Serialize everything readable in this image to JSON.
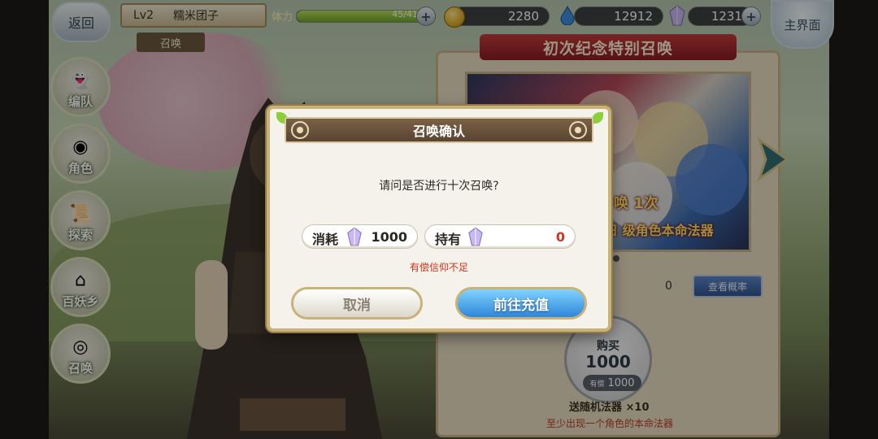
{
  "header": {
    "back_label": "返回",
    "level": "Lv2",
    "player_name": "糯米团子",
    "current_tab": "召唤",
    "stamina_label": "体力",
    "stamina_value": "45/41",
    "stamina_fill": 1.0,
    "gold": "2280",
    "spirit": "12912",
    "crystal": "1231",
    "home_label": "主界面"
  },
  "sidebar": {
    "items": [
      {
        "label": "编队",
        "icon": "ghost-icon"
      },
      {
        "label": "角色",
        "icon": "character-icon"
      },
      {
        "label": "探索",
        "icon": "scroll-icon"
      },
      {
        "label": "百妖乡",
        "icon": "village-icon"
      },
      {
        "label": "召唤",
        "icon": "summon-icon"
      }
    ]
  },
  "banner": {
    "title": "初次纪念特别召唤",
    "art_text_1": "唤 1次",
    "art_text_2": "日 级角色本命法器",
    "owned_count": "0",
    "rate_button": "查看概率",
    "buy_label": "购买",
    "buy_price": "1000",
    "owned_price_prefix": "有偿",
    "owned_price": "1000",
    "bonus_text": "送随机法器 ×10",
    "hint_text": "至少出现一个角色的本命法器"
  },
  "modal": {
    "title": "召唤确认",
    "question": "请问是否进行十次召唤?",
    "cost_label": "消耗",
    "cost_value": "1000",
    "held_label": "持有",
    "held_value": "0",
    "warning": "有偿信仰不足",
    "cancel_label": "取消",
    "charge_label": "前往充值"
  },
  "colors": {
    "accent_red": "#d0321e",
    "charge_blue": "#2f86d8",
    "frame_gold": "#c9b27a"
  }
}
